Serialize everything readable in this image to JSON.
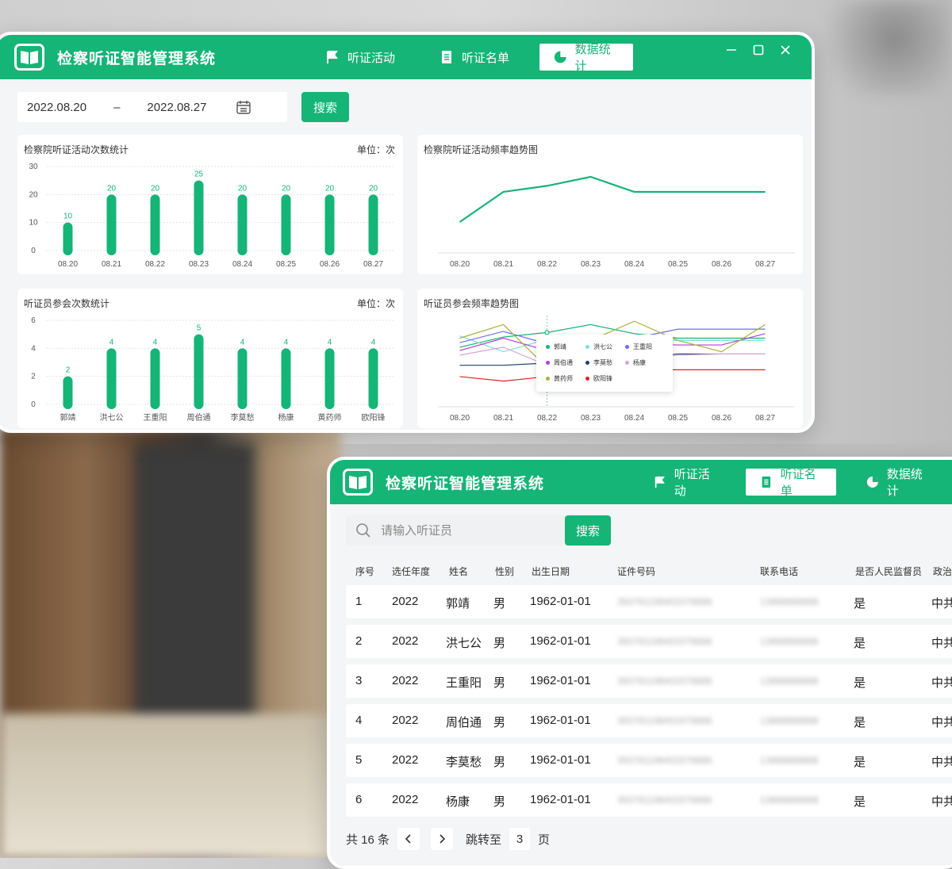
{
  "app_title": "检察听证智能管理系统",
  "nav": {
    "activities": "听证活动",
    "roster": "听证名单",
    "stats": "数据统计"
  },
  "colors": {
    "brand": "#15b477",
    "bg": "#f4f5f6"
  },
  "stats_window": {
    "date_start": "2022.08.20",
    "date_sep": "–",
    "date_end": "2022.08.27",
    "search_label": "搜索",
    "cards": {
      "activity_count_title": "检察院听证活动次数统计",
      "activity_freq_title": "检察院听证活动频率趋势图",
      "participant_count_title": "听证员参会次数统计",
      "participant_freq_title": "听证员参会频率趋势图",
      "unit_label": "单位：次"
    }
  },
  "chart_data": [
    {
      "type": "bar",
      "title": "检察院听证活动次数统计",
      "unit": "单位：次",
      "categories": [
        "08.20",
        "08.21",
        "08.22",
        "08.23",
        "08.24",
        "08.25",
        "08.26",
        "08.27"
      ],
      "values": [
        10,
        20,
        20,
        25,
        20,
        20,
        20,
        20
      ],
      "y_ticks": [
        "0",
        "10",
        "20",
        "30"
      ],
      "ylim": [
        0,
        30
      ]
    },
    {
      "type": "line",
      "title": "检察院听证活动频率趋势图",
      "categories": [
        "08.20",
        "08.21",
        "08.22",
        "08.23",
        "08.24",
        "08.25",
        "08.26",
        "08.27"
      ],
      "values": [
        10,
        20,
        22,
        25,
        20,
        20,
        20,
        20
      ],
      "ylim": [
        0,
        30
      ]
    },
    {
      "type": "bar",
      "title": "听证员参会次数统计",
      "unit": "单位：次",
      "categories": [
        "郭靖",
        "洪七公",
        "王重阳",
        "周伯通",
        "李莫愁",
        "杨康",
        "黄药师",
        "欧阳锋"
      ],
      "values": [
        2,
        4,
        4,
        5,
        4,
        4,
        4,
        4
      ],
      "y_ticks": [
        "0",
        "2",
        "4",
        "6"
      ],
      "ylim": [
        0,
        6
      ]
    },
    {
      "type": "line",
      "title": "听证员参会频率趋势图",
      "categories": [
        "08.20",
        "08.21",
        "08.22",
        "08.23",
        "08.24",
        "08.25",
        "08.26",
        "08.27"
      ],
      "ylim": [
        0,
        8
      ],
      "series": [
        {
          "name": "郭靖",
          "color": "#15b477",
          "values": [
            5.2,
            6.1,
            6.5,
            7.2,
            6.4,
            6.0,
            6.0,
            6.0
          ]
        },
        {
          "name": "洪七公",
          "color": "#7fdfe6",
          "values": [
            6.2,
            4.8,
            5.9,
            5.6,
            5.8,
            5.8,
            5.8,
            5.8
          ]
        },
        {
          "name": "王重阳",
          "color": "#6a6ff0",
          "values": [
            5.6,
            6.6,
            5.5,
            5.9,
            6.0,
            6.8,
            6.8,
            6.8
          ]
        },
        {
          "name": "周伯通",
          "color": "#b43fd6",
          "values": [
            4.9,
            6.0,
            4.9,
            5.6,
            5.5,
            5.4,
            5.4,
            6.4
          ]
        },
        {
          "name": "李莫愁",
          "color": "#1d3f6e",
          "values": [
            3.6,
            3.6,
            3.8,
            4.0,
            4.2,
            4.6,
            4.6,
            4.6
          ]
        },
        {
          "name": "杨康",
          "color": "#d9a3d6",
          "values": [
            4.5,
            5.2,
            3.6,
            4.0,
            4.4,
            4.5,
            4.6,
            4.6
          ]
        },
        {
          "name": "黄药师",
          "color": "#a6b23a",
          "values": [
            6.0,
            7.2,
            3.4,
            5.8,
            7.5,
            5.8,
            4.8,
            7.2
          ]
        },
        {
          "name": "欧阳锋",
          "color": "#e02424",
          "values": [
            2.6,
            2.2,
            2.6,
            2.8,
            3.2,
            3.2,
            3.2,
            3.2
          ]
        }
      ]
    }
  ],
  "roster_window": {
    "search_placeholder": "请输入听证员",
    "search_label": "搜索",
    "columns": [
      "序号",
      "选任年度",
      "姓名",
      "性别",
      "出生日期",
      "证件号码",
      "联系电话",
      "是否人民监督员",
      "政治面"
    ],
    "rows": [
      [
        "1",
        "2022",
        "郭靖",
        "男",
        "1962-01-01",
        "350781198402078888",
        "13888888888",
        "是",
        "中共"
      ],
      [
        "2",
        "2022",
        "洪七公",
        "男",
        "1962-01-01",
        "350781198402078888",
        "13888888888",
        "是",
        "中共"
      ],
      [
        "3",
        "2022",
        "王重阳",
        "男",
        "1962-01-01",
        "350781198402078888",
        "13888888888",
        "是",
        "中共"
      ],
      [
        "4",
        "2022",
        "周伯通",
        "男",
        "1962-01-01",
        "350781198402078888",
        "13888888888",
        "是",
        "中共"
      ],
      [
        "5",
        "2022",
        "李莫愁",
        "男",
        "1962-01-01",
        "350781198402078888",
        "13888888888",
        "是",
        "中共"
      ],
      [
        "6",
        "2022",
        "杨康",
        "男",
        "1962-01-01",
        "350781198402078888",
        "13888888888",
        "是",
        "中共"
      ]
    ],
    "pager": {
      "total_text": "共 16 条",
      "jump_label": "跳转至",
      "page_value": "3",
      "page_suffix": "页"
    }
  }
}
